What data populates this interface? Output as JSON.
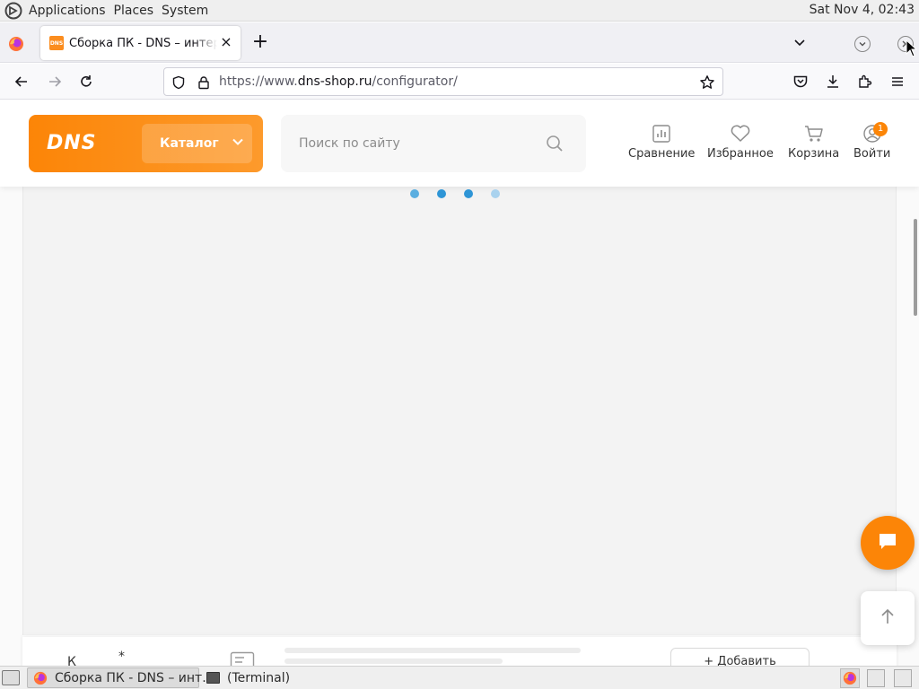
{
  "top_panel": {
    "menus": [
      "Applications",
      "Places",
      "System"
    ],
    "clock": "Sat Nov  4, 02:43"
  },
  "browser": {
    "tab": {
      "favicon_text": "DNS",
      "title": "Сборка ПК - DNS – интернет магазин"
    },
    "url": {
      "scheme": "https://www.",
      "host": "dns-shop.ru",
      "path": "/configurator/"
    }
  },
  "site": {
    "logo": "DNS",
    "catalog_label": "Каталог",
    "search_placeholder": "Поиск по сайту",
    "header_items": [
      {
        "label": "Сравнение",
        "icon": "compare-icon"
      },
      {
        "label": "Избранное",
        "icon": "heart-icon"
      },
      {
        "label": "Корзина",
        "icon": "cart-icon"
      },
      {
        "label": "Войти",
        "icon": "user-icon"
      }
    ],
    "notification_badge": "1",
    "bottom_bar": {
      "category_label": "К",
      "required_mark": "*",
      "add_button": "+ Добавить"
    },
    "loading_dot_colors": [
      "#5aaee0",
      "#2e95d6",
      "#2e95d6",
      "#a9d2ee"
    ],
    "accent_color": "#fc8507"
  },
  "taskbar": {
    "items": [
      {
        "label": "Сборка ПК - DNS – инт...",
        "icon": "firefox-icon",
        "active": true
      },
      {
        "label": "(Terminal)",
        "icon": "terminal-icon",
        "active": false
      }
    ]
  }
}
